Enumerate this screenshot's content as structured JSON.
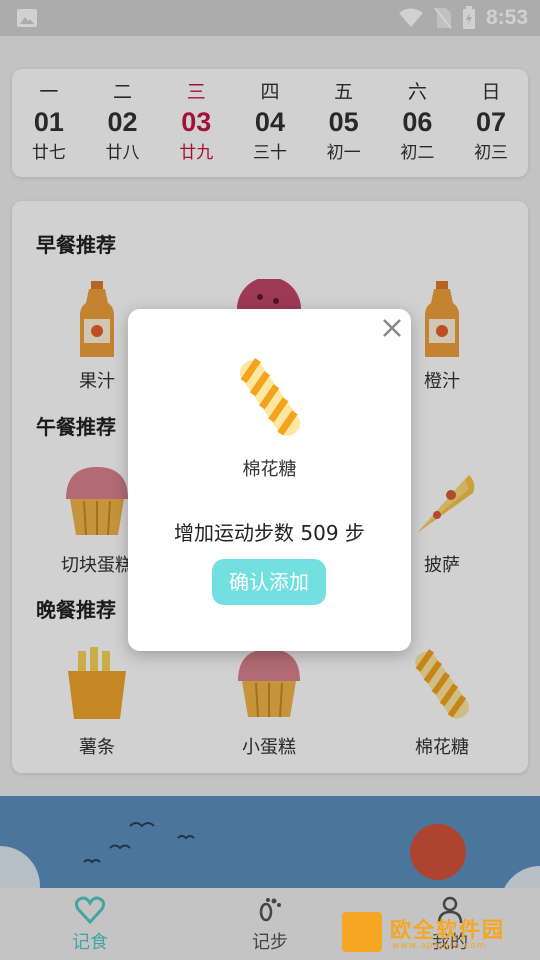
{
  "statusbar": {
    "time": "8:53"
  },
  "week": [
    {
      "weekday": "一",
      "date": "01",
      "lunar": "廿七",
      "active": false
    },
    {
      "weekday": "二",
      "date": "02",
      "lunar": "廿八",
      "active": false
    },
    {
      "weekday": "三",
      "date": "03",
      "lunar": "廿九",
      "active": true
    },
    {
      "weekday": "四",
      "date": "04",
      "lunar": "三十",
      "active": false
    },
    {
      "weekday": "五",
      "date": "05",
      "lunar": "初一",
      "active": false
    },
    {
      "weekday": "六",
      "date": "06",
      "lunar": "初二",
      "active": false
    },
    {
      "weekday": "日",
      "date": "07",
      "lunar": "初三",
      "active": false
    }
  ],
  "sections": {
    "breakfast": {
      "title": "早餐推荐",
      "items": [
        "果汁",
        "",
        "橙汁"
      ]
    },
    "lunch": {
      "title": "午餐推荐",
      "items": [
        "切块蛋糕",
        "",
        "披萨"
      ]
    },
    "dinner": {
      "title": "晚餐推荐",
      "items": [
        "薯条",
        "小蛋糕",
        "棉花糖"
      ]
    }
  },
  "dialog": {
    "food_name": "棉花糖",
    "message": "增加运动步数 509 步",
    "confirm_label": "确认添加"
  },
  "nav": [
    {
      "label": "记食",
      "icon": "heart-icon",
      "active": true
    },
    {
      "label": "记步",
      "icon": "footprint-icon",
      "active": false
    },
    {
      "label": "我的",
      "icon": "person-icon",
      "active": false
    }
  ],
  "watermark": {
    "text": "欧全软件园",
    "sub": "www.apoujin.com"
  },
  "colors": {
    "accent": "#52c8c6",
    "today": "#c21845",
    "button": "#72e0e0"
  }
}
